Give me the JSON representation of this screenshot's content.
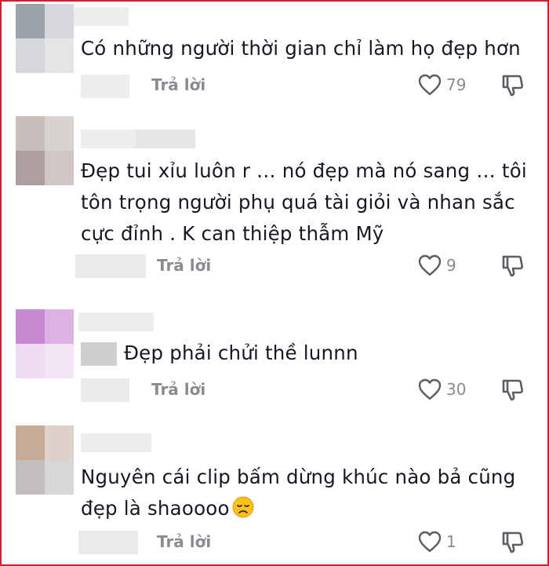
{
  "reply_label": "Trả lời",
  "comments": [
    {
      "text_lines": [
        "Có những người thời gian chỉ làm họ đẹp hơn"
      ],
      "likes": "79"
    },
    {
      "text_lines": [
        "Đẹp tui xỉu luôn r … nó đẹp mà nó sang … tôi",
        "tôn trọng người phụ quá tài giỏi và nhan sắc",
        "cực đỉnh . K can thiệp thẫm Mỹ"
      ],
      "likes": "9"
    },
    {
      "text_lines": [
        "Đẹp phải chửi thề lunnn"
      ],
      "likes": "30"
    },
    {
      "text_lines": [
        "Nguyên cái clip bấm dừng khúc nào bả cũng",
        "đẹp là shaoooo"
      ],
      "likes": "1"
    }
  ],
  "colors": {
    "border": "#d81b2a",
    "meta_text": "#8a8b91",
    "text": "#161823"
  },
  "icons": {
    "like": "heart-outline-icon",
    "dislike": "thumbs-down-outline-icon",
    "emoji": "disappointed-face-emoji"
  }
}
